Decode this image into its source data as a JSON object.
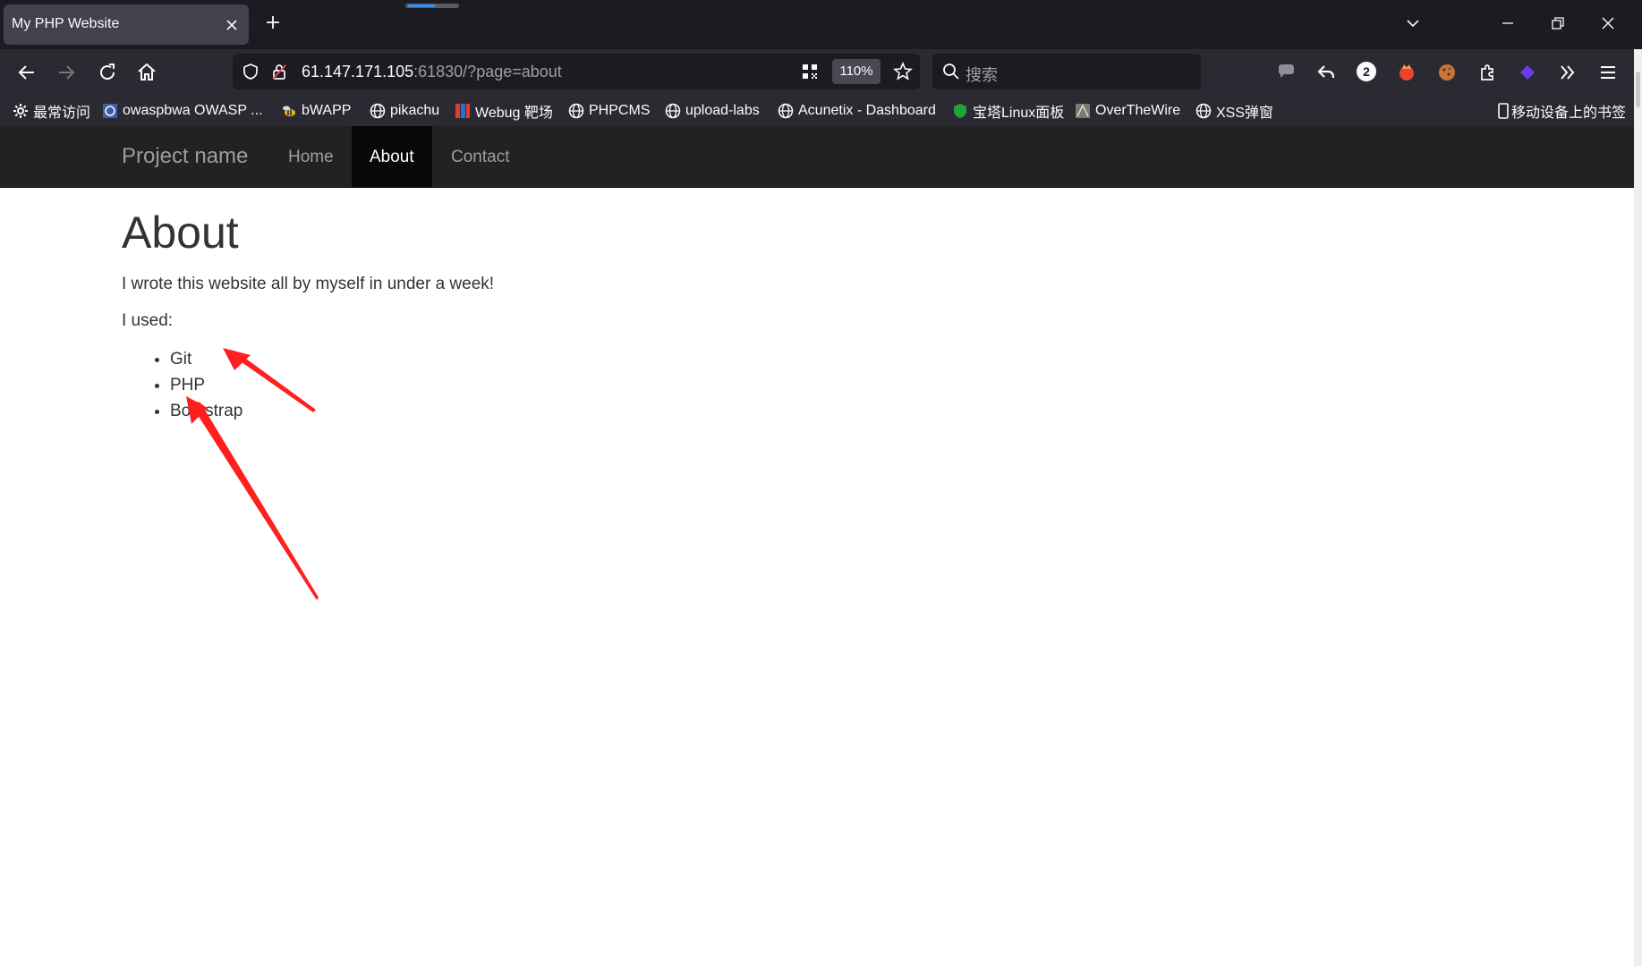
{
  "browser": {
    "tab_title": "My PHP Website",
    "url_host": "61.147.171.105",
    "url_rest": ":61830/?page=about",
    "zoom": "110%",
    "search_placeholder": "搜索",
    "extension_badge": "2"
  },
  "bookmarks": [
    {
      "label": "最常访问",
      "icon": "gear-icon"
    },
    {
      "label": "owaspbwa OWASP ...",
      "icon": "owasp-icon"
    },
    {
      "label": "bWAPP",
      "icon": "bee-icon"
    },
    {
      "label": "pikachu",
      "icon": "globe-icon"
    },
    {
      "label": "Webug 靶场",
      "icon": "webug-icon"
    },
    {
      "label": "PHPCMS",
      "icon": "globe-icon"
    },
    {
      "label": "upload-labs",
      "icon": "globe-icon"
    },
    {
      "label": "Acunetix - Dashboard",
      "icon": "globe-icon"
    },
    {
      "label": "宝塔Linux面板",
      "icon": "bt-panel-icon"
    },
    {
      "label": "OverTheWire",
      "icon": "otw-icon"
    },
    {
      "label": "XSS弹窗",
      "icon": "globe-icon"
    }
  ],
  "mobile_bookmarks": "移动设备上的书签",
  "site": {
    "brand": "Project name",
    "nav": [
      "Home",
      "About",
      "Contact"
    ],
    "active_nav": "About",
    "heading": "About",
    "intro": "I wrote this website all by myself in under a week!",
    "used_label": "I used:",
    "tech": [
      "Git",
      "PHP",
      "Bootstrap"
    ]
  },
  "annotation_color": "#ff1f1f"
}
